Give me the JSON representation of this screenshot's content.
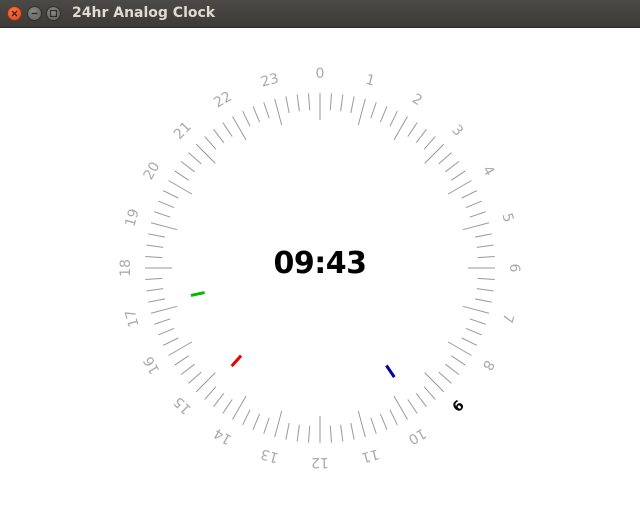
{
  "window": {
    "title": "24hr Analog Clock",
    "buttons": [
      {
        "name": "close",
        "icon": "close-icon"
      },
      {
        "name": "minimize",
        "icon": "minimize-icon"
      },
      {
        "name": "maximize",
        "icon": "maximize-icon"
      }
    ]
  },
  "clock": {
    "digital_time": "09:43",
    "hour_labels": [
      "0",
      "1",
      "2",
      "3",
      "4",
      "5",
      "6",
      "7",
      "8",
      "9",
      "10",
      "11",
      "12",
      "13",
      "14",
      "15",
      "16",
      "17",
      "18",
      "19",
      "20",
      "21",
      "22",
      "23"
    ],
    "current_hour_label": "9",
    "hands": [
      {
        "name": "hour-hand",
        "value": 9.716,
        "unit": "hours-of-24",
        "color": "#0000aa"
      },
      {
        "name": "minute-hand",
        "value": 43,
        "unit": "minutes",
        "color": "#00bb00"
      },
      {
        "name": "second-hand",
        "value": 37,
        "unit": "seconds",
        "color": "#ee0000"
      }
    ],
    "colors": {
      "label": "#aaaaaa",
      "tick": "#999999",
      "highlight_label": "#000000"
    }
  }
}
